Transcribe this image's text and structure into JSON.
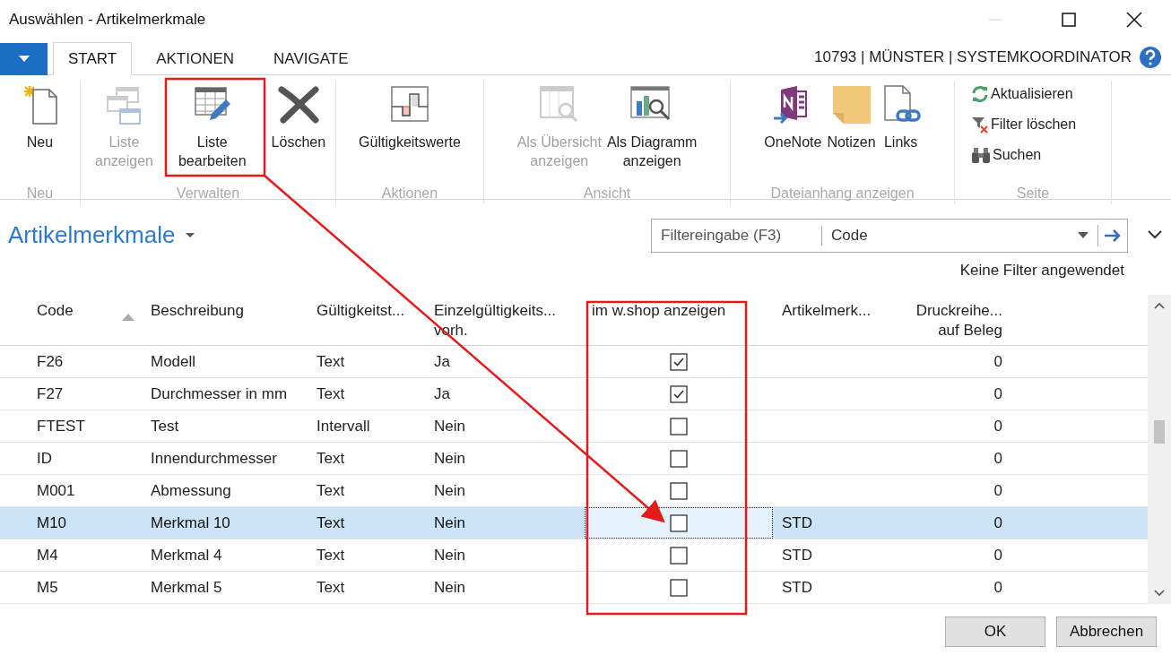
{
  "window": {
    "title": "Auswählen - Artikelmerkmale"
  },
  "tabs": [
    {
      "label": "START",
      "selected": true
    },
    {
      "label": "AKTIONEN",
      "selected": false
    },
    {
      "label": "NAVIGATE",
      "selected": false
    }
  ],
  "context": "10793 | MÜNSTER | SYSTEMKOORDINATOR",
  "ribbon_groups": [
    {
      "label": "Neu",
      "items": [
        {
          "label": "Neu",
          "disabled": false
        }
      ]
    },
    {
      "label": "Verwalten",
      "items": [
        {
          "label": "Liste anzeigen",
          "disabled": true
        },
        {
          "label": "Liste bearbeiten",
          "disabled": false
        },
        {
          "label": "Löschen",
          "disabled": false
        }
      ]
    },
    {
      "label": "Aktionen",
      "items": [
        {
          "label": "Gültigkeitswerte",
          "disabled": false
        }
      ]
    },
    {
      "label": "Ansicht",
      "items": [
        {
          "label": "Als Übersicht anzeigen",
          "disabled": true
        },
        {
          "label": "Als Diagramm anzeigen",
          "disabled": false
        }
      ]
    },
    {
      "label": "Dateianhang anzeigen",
      "items": [
        {
          "label": "OneNote",
          "disabled": false
        },
        {
          "label": "Notizen",
          "disabled": false
        },
        {
          "label": "Links",
          "disabled": false
        }
      ]
    },
    {
      "label": "Seite",
      "items": [
        {
          "label": "Aktualisieren",
          "disabled": false
        },
        {
          "label": "Filter löschen",
          "disabled": false
        },
        {
          "label": "Suchen",
          "disabled": false
        }
      ]
    }
  ],
  "page_title": "Artikelmerkmale",
  "filter": {
    "placeholder": "Filtereingabe (F3)",
    "field": "Code"
  },
  "filter_status": "Keine Filter angewendet",
  "table": {
    "columns": [
      "Code",
      "Beschreibung",
      "Gültigkeitst...",
      "Einzelgültigkeits... vorh.",
      "im w.shop anzeigen",
      "Artikelmerk...",
      "Druckreihe... auf Beleg"
    ],
    "rows": [
      {
        "code": "F26",
        "beschreibung": "Modell",
        "typ": "Text",
        "einzel": "Ja",
        "shop": true,
        "merk": "",
        "druck": "0",
        "selected": false
      },
      {
        "code": "F27",
        "beschreibung": "Durchmesser in mm",
        "typ": "Text",
        "einzel": "Ja",
        "shop": true,
        "merk": "",
        "druck": "0",
        "selected": false
      },
      {
        "code": "FTEST",
        "beschreibung": "Test",
        "typ": "Intervall",
        "einzel": "Nein",
        "shop": false,
        "merk": "",
        "druck": "0",
        "selected": false
      },
      {
        "code": "ID",
        "beschreibung": "Innendurchmesser",
        "typ": "Text",
        "einzel": "Nein",
        "shop": false,
        "merk": "",
        "druck": "0",
        "selected": false
      },
      {
        "code": "M001",
        "beschreibung": "Abmessung",
        "typ": "Text",
        "einzel": "Nein",
        "shop": false,
        "merk": "",
        "druck": "0",
        "selected": false
      },
      {
        "code": "M10",
        "beschreibung": "Merkmal 10",
        "typ": "Text",
        "einzel": "Nein",
        "shop": false,
        "merk": "STD",
        "druck": "0",
        "selected": true
      },
      {
        "code": "M4",
        "beschreibung": "Merkmal 4",
        "typ": "Text",
        "einzel": "Nein",
        "shop": false,
        "merk": "STD",
        "druck": "0",
        "selected": false
      },
      {
        "code": "M5",
        "beschreibung": "Merkmal 5",
        "typ": "Text",
        "einzel": "Nein",
        "shop": false,
        "merk": "STD",
        "druck": "0",
        "selected": false
      }
    ]
  },
  "buttons": [
    "OK",
    "Abbrechen"
  ]
}
